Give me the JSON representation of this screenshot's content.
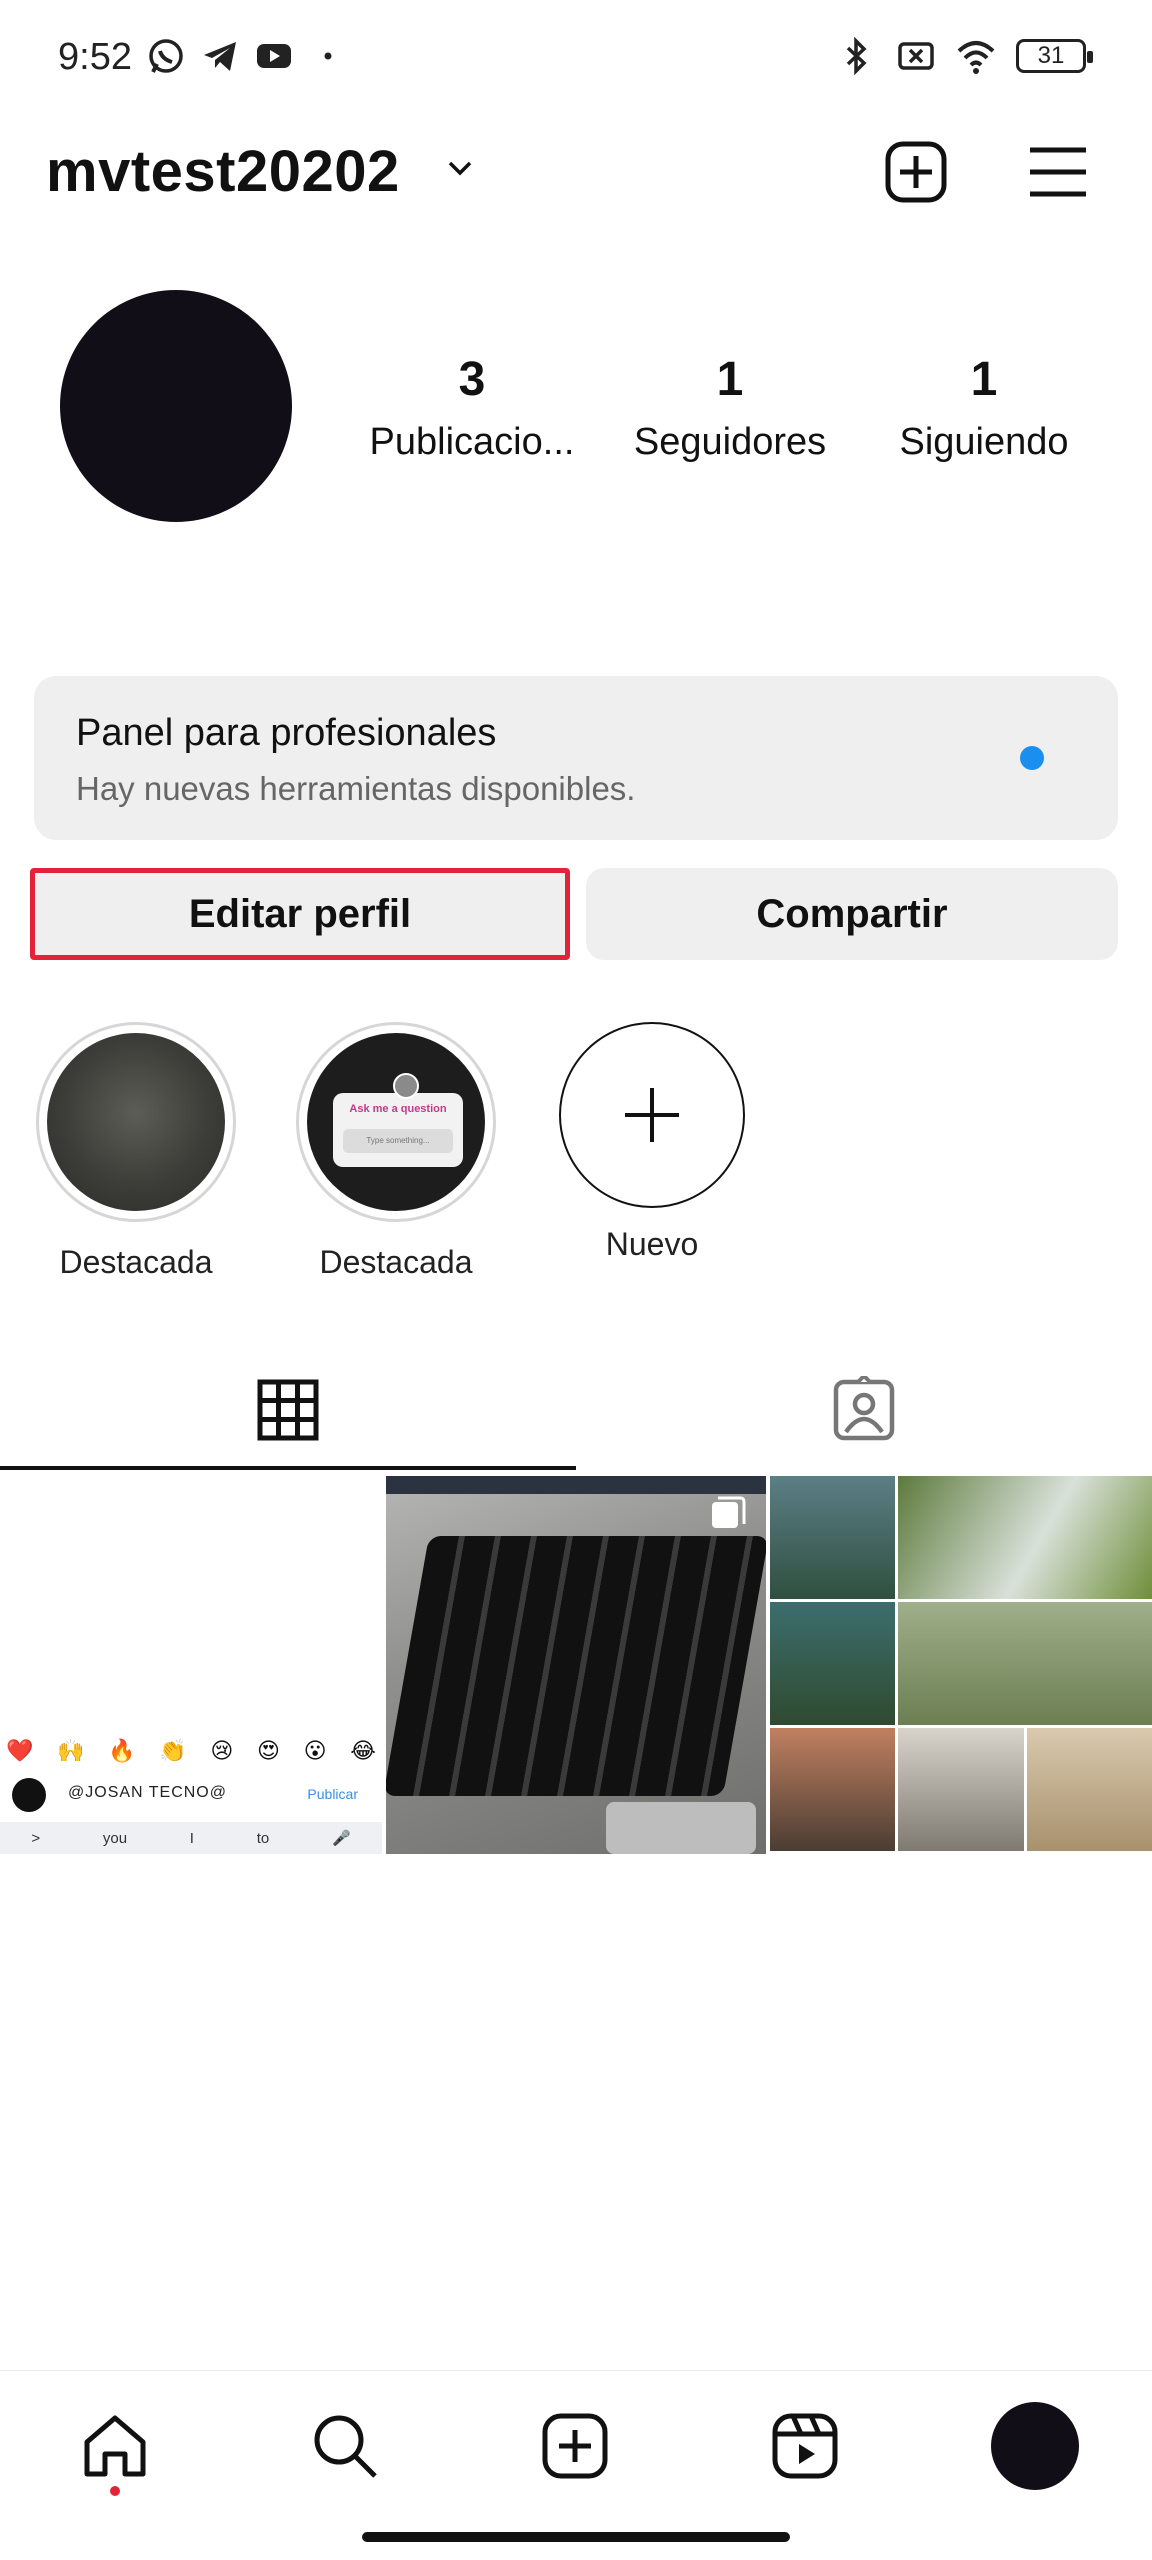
{
  "status_bar": {
    "time": "9:52",
    "battery": "31",
    "left_icons": [
      "whatsapp-icon",
      "telegram-icon",
      "youtube-icon",
      "dot-icon"
    ],
    "right_icons": [
      "bluetooth-icon",
      "no-sim-icon",
      "wifi-icon",
      "battery-icon"
    ]
  },
  "header": {
    "username": "mvtest20202",
    "icons": [
      "chevron-down-icon",
      "add-square-icon",
      "hamburger-menu-icon"
    ]
  },
  "profile": {
    "stats": [
      {
        "value": "3",
        "label": "Publicacio..."
      },
      {
        "value": "1",
        "label": "Seguidores"
      },
      {
        "value": "1",
        "label": "Siguiendo"
      }
    ]
  },
  "pro_panel": {
    "title": "Panel para profesionales",
    "subtitle": "Hay nuevas herramientas disponibles.",
    "dot_color": "#1a8ff0"
  },
  "buttons": {
    "edit": "Editar perfil",
    "share": "Compartir",
    "highlight_color": "#e2233a"
  },
  "highlights": [
    {
      "label": "Destacada"
    },
    {
      "label": "Destacada",
      "ask_title": "Ask me a question",
      "ask_field": "Type something..."
    },
    {
      "label": "Nuevo"
    }
  ],
  "tabs": [
    "grid-icon",
    "tagged-icon"
  ],
  "posts": {
    "post1": {
      "emojis": [
        "❤️",
        "🙌",
        "🔥",
        "👏",
        "😢",
        "😍",
        "😮",
        "😂"
      ],
      "comment_user": "@JOSAN TECNO@",
      "comment_action": "Publicar",
      "keyboard": [
        ">",
        "you",
        "I",
        "to",
        "🎤"
      ]
    }
  },
  "bottom_nav": [
    "home-icon",
    "search-icon",
    "create-icon",
    "reels-icon",
    "profile-avatar"
  ]
}
